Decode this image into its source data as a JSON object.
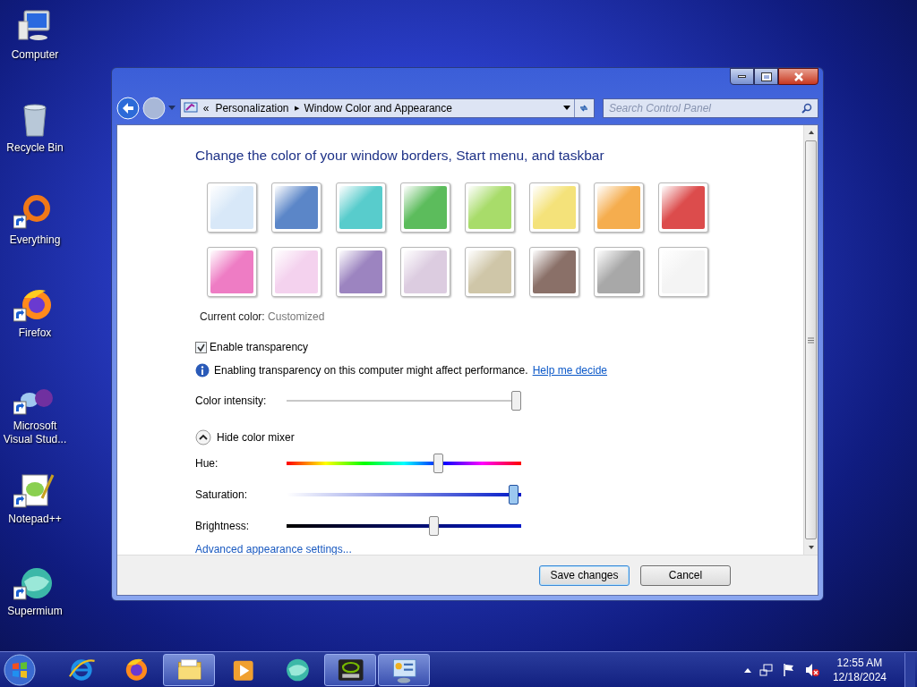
{
  "desktop_icons": [
    {
      "label": "Computer",
      "kind": "computer",
      "shortcut": false
    },
    {
      "label": "Recycle Bin",
      "kind": "bin",
      "shortcut": false
    },
    {
      "label": "Everything",
      "kind": "ring",
      "shortcut": true
    },
    {
      "label": "Firefox",
      "kind": "fox",
      "shortcut": true
    },
    {
      "label": "Microsoft Visual Stud...",
      "kind": "vs",
      "shortcut": true
    },
    {
      "label": "Notepad++",
      "kind": "notepad",
      "shortcut": true
    },
    {
      "label": "Supermium",
      "kind": "globe",
      "shortcut": true
    }
  ],
  "window": {
    "address": {
      "crumbs": [
        "Personalization",
        "Window Color and Appearance"
      ],
      "separator": "«",
      "arrow": "▶"
    },
    "search": {
      "placeholder": "Search Control Panel"
    },
    "heading": "Change the color of your window borders, Start menu, and taskbar",
    "swatches": [
      {
        "color": "#d8e8f8"
      },
      {
        "color": "#5b86c8"
      },
      {
        "color": "#58cccc"
      },
      {
        "color": "#5cbc5c"
      },
      {
        "color": "#a8dc6a"
      },
      {
        "color": "#f4e27a"
      },
      {
        "color": "#f5ad4e"
      },
      {
        "color": "#dc4c4c"
      },
      {
        "color": "#ee7cc4"
      },
      {
        "color": "#f4d2ee"
      },
      {
        "color": "#9c84c0"
      },
      {
        "color": "#dccce0"
      },
      {
        "color": "#cfc6a8"
      },
      {
        "color": "#8a7068"
      },
      {
        "color": "#a8a8a8"
      },
      {
        "color": "#f4f4f4"
      }
    ],
    "current_color": {
      "label": "Current color:",
      "value": "Customized"
    },
    "transparency": {
      "label": "Enable transparency",
      "checked": true
    },
    "info": {
      "text": "Enabling transparency on this computer might affect performance.",
      "link": "Help me decide"
    },
    "intensity": {
      "label": "Color intensity:",
      "level": 0.98
    },
    "mixer": {
      "label": "Hide color mixer",
      "expanded": true,
      "sliders": [
        {
          "kind": "hue",
          "label": "Hue:",
          "level": 0.65
        },
        {
          "kind": "saturation",
          "label": "Saturation:",
          "level": 0.97
        },
        {
          "kind": "brightness",
          "label": "Brightness:",
          "level": 0.63
        }
      ]
    },
    "advanced_link": "Advanced appearance settings...",
    "buttons": [
      {
        "label": "Save changes",
        "default": true
      },
      {
        "label": "Cancel",
        "default": false
      }
    ]
  },
  "taskbar": {
    "items": [
      {
        "kind": "ie",
        "running": false
      },
      {
        "kind": "fox",
        "running": false
      },
      {
        "kind": "folder",
        "running": true
      },
      {
        "kind": "media",
        "running": false
      },
      {
        "kind": "globe",
        "running": false
      },
      {
        "kind": "nvidia",
        "running": true
      },
      {
        "kind": "panel",
        "running": true
      }
    ],
    "clock": {
      "time": "12:55 AM",
      "date": "12/18/2024"
    }
  }
}
